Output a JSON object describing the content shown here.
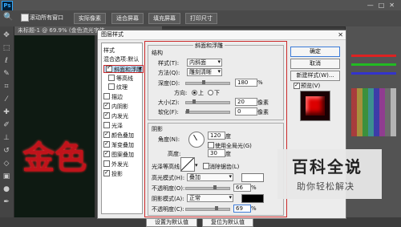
{
  "menubar": {
    "app_icon": "Ps"
  },
  "optbar": {
    "show_all_windows": "滚动所有窗口",
    "actual_pixels": "实际像素",
    "fit_screen": "适合屏幕",
    "fill_screen": "填充屏幕",
    "print_size": "打印尺寸"
  },
  "document": {
    "tab_title": "未标题-1 @ 69.9% (金色流光字体"
  },
  "dialog": {
    "title": "图层样式",
    "style_list": [
      {
        "label": "样式",
        "has_check": false,
        "checked": false,
        "selected": false
      },
      {
        "label": "混合选项:默认",
        "has_check": false,
        "checked": false,
        "selected": false
      },
      {
        "label": "斜面和浮雕",
        "has_check": true,
        "checked": true,
        "selected": true
      },
      {
        "label": "等高线",
        "has_check": true,
        "checked": false,
        "selected": false,
        "indent": true
      },
      {
        "label": "纹理",
        "has_check": true,
        "checked": false,
        "selected": false,
        "indent": true
      },
      {
        "label": "描边",
        "has_check": true,
        "checked": false,
        "selected": false
      },
      {
        "label": "内阴影",
        "has_check": true,
        "checked": true,
        "selected": false
      },
      {
        "label": "内发光",
        "has_check": true,
        "checked": true,
        "selected": false
      },
      {
        "label": "光泽",
        "has_check": true,
        "checked": false,
        "selected": false
      },
      {
        "label": "颜色叠加",
        "has_check": true,
        "checked": true,
        "selected": false
      },
      {
        "label": "渐变叠加",
        "has_check": true,
        "checked": true,
        "selected": false
      },
      {
        "label": "图案叠加",
        "has_check": true,
        "checked": true,
        "selected": false
      },
      {
        "label": "外发光",
        "has_check": true,
        "checked": false,
        "selected": false
      },
      {
        "label": "投影",
        "has_check": true,
        "checked": true,
        "selected": false
      }
    ],
    "bevel": {
      "section_title": "斜面和浮雕",
      "structure_title": "结构",
      "style_label": "样式(T):",
      "style_value": "内斜面",
      "technique_label": "方法(Q):",
      "technique_value": "雕刻清晰",
      "depth_label": "深度(D):",
      "depth_value": "180",
      "depth_unit": "%",
      "direction_label": "方向:",
      "dir_up": "上",
      "dir_down": "下",
      "size_label": "大小(Z):",
      "size_value": "20",
      "size_unit": "像素",
      "soften_label": "软化(F):",
      "soften_value": "0",
      "soften_unit": "像素"
    },
    "shading": {
      "title": "阴影",
      "angle_label": "角度(N):",
      "angle_value": "120",
      "angle_unit": "度",
      "global_light_label": "使用全局光(G)",
      "altitude_label": "高度:",
      "altitude_value": "30",
      "altitude_unit": "度",
      "gloss_label": "光泽等高线:",
      "anti_alias_label": "消除锯齿(L)",
      "highlight_mode_label": "高光模式(H):",
      "highlight_mode_value": "叠加",
      "highlight_opacity_label": "不透明度(O):",
      "highlight_opacity_value": "66",
      "shadow_mode_label": "阴影模式(A):",
      "shadow_mode_value": "正常",
      "shadow_opacity_label": "不透明度(C):",
      "shadow_opacity_value": "69",
      "pct": "%"
    },
    "buttons": {
      "ok": "确定",
      "cancel": "取消",
      "new_style": "新建样式(W)...",
      "preview": "预览(V)",
      "set_default": "设置为默认值",
      "reset_default": "复位为默认值"
    }
  },
  "watermark": {
    "title": "百科全说",
    "subtitle": "助你轻松解决"
  }
}
